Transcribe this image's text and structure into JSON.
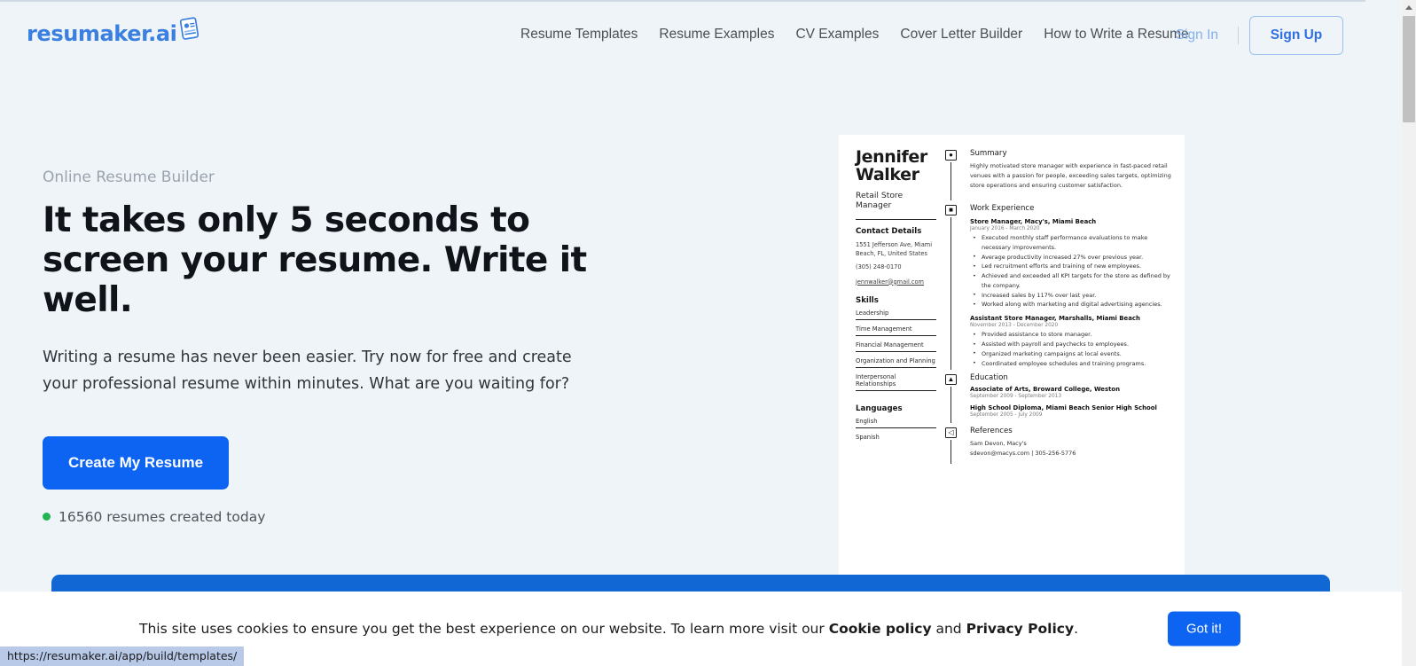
{
  "header": {
    "logo_text": "resumaker.ai",
    "logo_icon": "resume-document-icon",
    "nav": [
      {
        "label": "Resume Templates"
      },
      {
        "label": "Resume Examples"
      },
      {
        "label": "CV Examples"
      },
      {
        "label": "Cover Letter Builder"
      },
      {
        "label": "How to Write a Resume"
      }
    ],
    "sign_in_label": "Sign In",
    "sign_up_label": "Sign Up"
  },
  "hero": {
    "eyebrow": "Online Resume Builder",
    "title": "It takes only 5 seconds to screen your resume. Write it well.",
    "subtitle": "Writing a resume has never been easier. Try now for free and create your professional resume within minutes. What are you waiting for?",
    "cta_label": "Create My Resume",
    "counter_text": "16560 resumes created today",
    "counter_dot_color": "#22b352",
    "accent_color": "#0d64f2"
  },
  "resume_preview": {
    "name": "Jennifer Walker",
    "role": "Retail Store Manager",
    "contact_heading": "Contact Details",
    "address_line_1": "1551 Jefferson Ave, Miami",
    "address_line_2": "Beach, FL, United States",
    "phone": "(305) 248-0170",
    "email": "jennwalker@gmail.com",
    "skills_heading": "Skills",
    "skills": [
      "Leadership",
      "Time Management",
      "Financial Management",
      "Organization and Planning",
      "Interpersonal Relationships"
    ],
    "languages_heading": "Languages",
    "languages": [
      "English",
      "Spanish"
    ],
    "summary_heading": "Summary",
    "summary_icon": "person-badge-icon",
    "summary_text": "Highly motivated store manager with experience in fast-paced retail venues with a passion for people, exceeding sales targets, optimizing store operations and ensuring customer satisfaction.",
    "work_heading": "Work Experience",
    "work_icon": "briefcase-icon",
    "jobs": [
      {
        "title": "Store Manager, Macy's, Miami Beach",
        "dates": "January 2016 - March 2020",
        "bullets": [
          "Executed monthly staff performance evaluations to make necessary improvements.",
          "Average productivity increased 27% over previous year.",
          "Led recruitment efforts and training of new employees.",
          "Achieved and exceeded all KPI targets for the store as defined by the company.",
          "Increased sales by 117% over last year.",
          "Worked along with marketing and digital advertising agencies."
        ]
      },
      {
        "title": "Assistant Store Manager, Marshalls, Miami Beach",
        "dates": "November 2013 - December 2020",
        "bullets": [
          "Provided assistance to store manager.",
          "Assisted with payroll and paychecks to employees.",
          "Organized marketing campaigns at local events.",
          "Coordinated employee schedules and training programs."
        ]
      }
    ],
    "education_heading": "Education",
    "education_icon": "graduation-cap-icon",
    "education": [
      {
        "title": "Associate of Arts, Broward College, Weston",
        "dates": "September 2009 - September 2013"
      },
      {
        "title": "High School Diploma, Miami Beach Senior High School",
        "dates": "September 2005 - July 2009"
      }
    ],
    "references_heading": "References",
    "references_icon": "megaphone-icon",
    "reference_name": "Sam Devon, Macy's",
    "reference_contact": "sdevon@macys.com | 305-256-5776"
  },
  "cookie": {
    "text_before": "This site uses cookies to ensure you get the best experience on our website. To learn more visit our ",
    "cookie_policy_label": "Cookie policy",
    "conjunction": " and ",
    "privacy_policy_label": "Privacy Policy",
    "period": ".",
    "accept_label": "Got it!"
  },
  "status_bar": {
    "url": "https://resumaker.ai/app/build/templates/"
  }
}
